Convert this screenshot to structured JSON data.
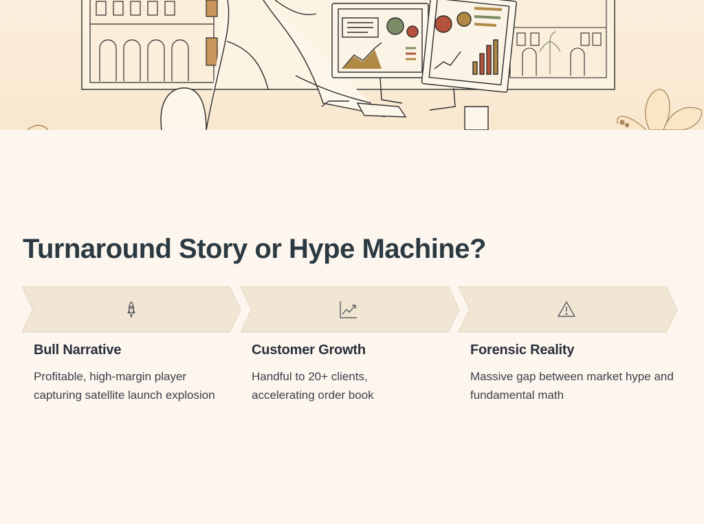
{
  "page": {
    "title": "Turnaround Story or Hype Machine?"
  },
  "steps": [
    {
      "icon": "rocket-icon",
      "heading": "Bull Narrative",
      "body": "Profitable, high-margin player capturing satellite launch explosion"
    },
    {
      "icon": "trending-up-chart-icon",
      "heading": "Customer Growth",
      "body": "Handful to 20+ clients, accelerating order book"
    },
    {
      "icon": "warning-triangle-icon",
      "heading": "Forensic Reality",
      "body": "Massive gap between market hype and fundamental math"
    }
  ],
  "colors": {
    "background": "#fcf6ef",
    "chevron_fill": "#f1e6d4",
    "chevron_stroke": "#e2d3bb",
    "title": "#2b3a42",
    "accent_red": "#b5523b",
    "accent_gold": "#b08a45",
    "accent_green": "#7d8c66"
  }
}
